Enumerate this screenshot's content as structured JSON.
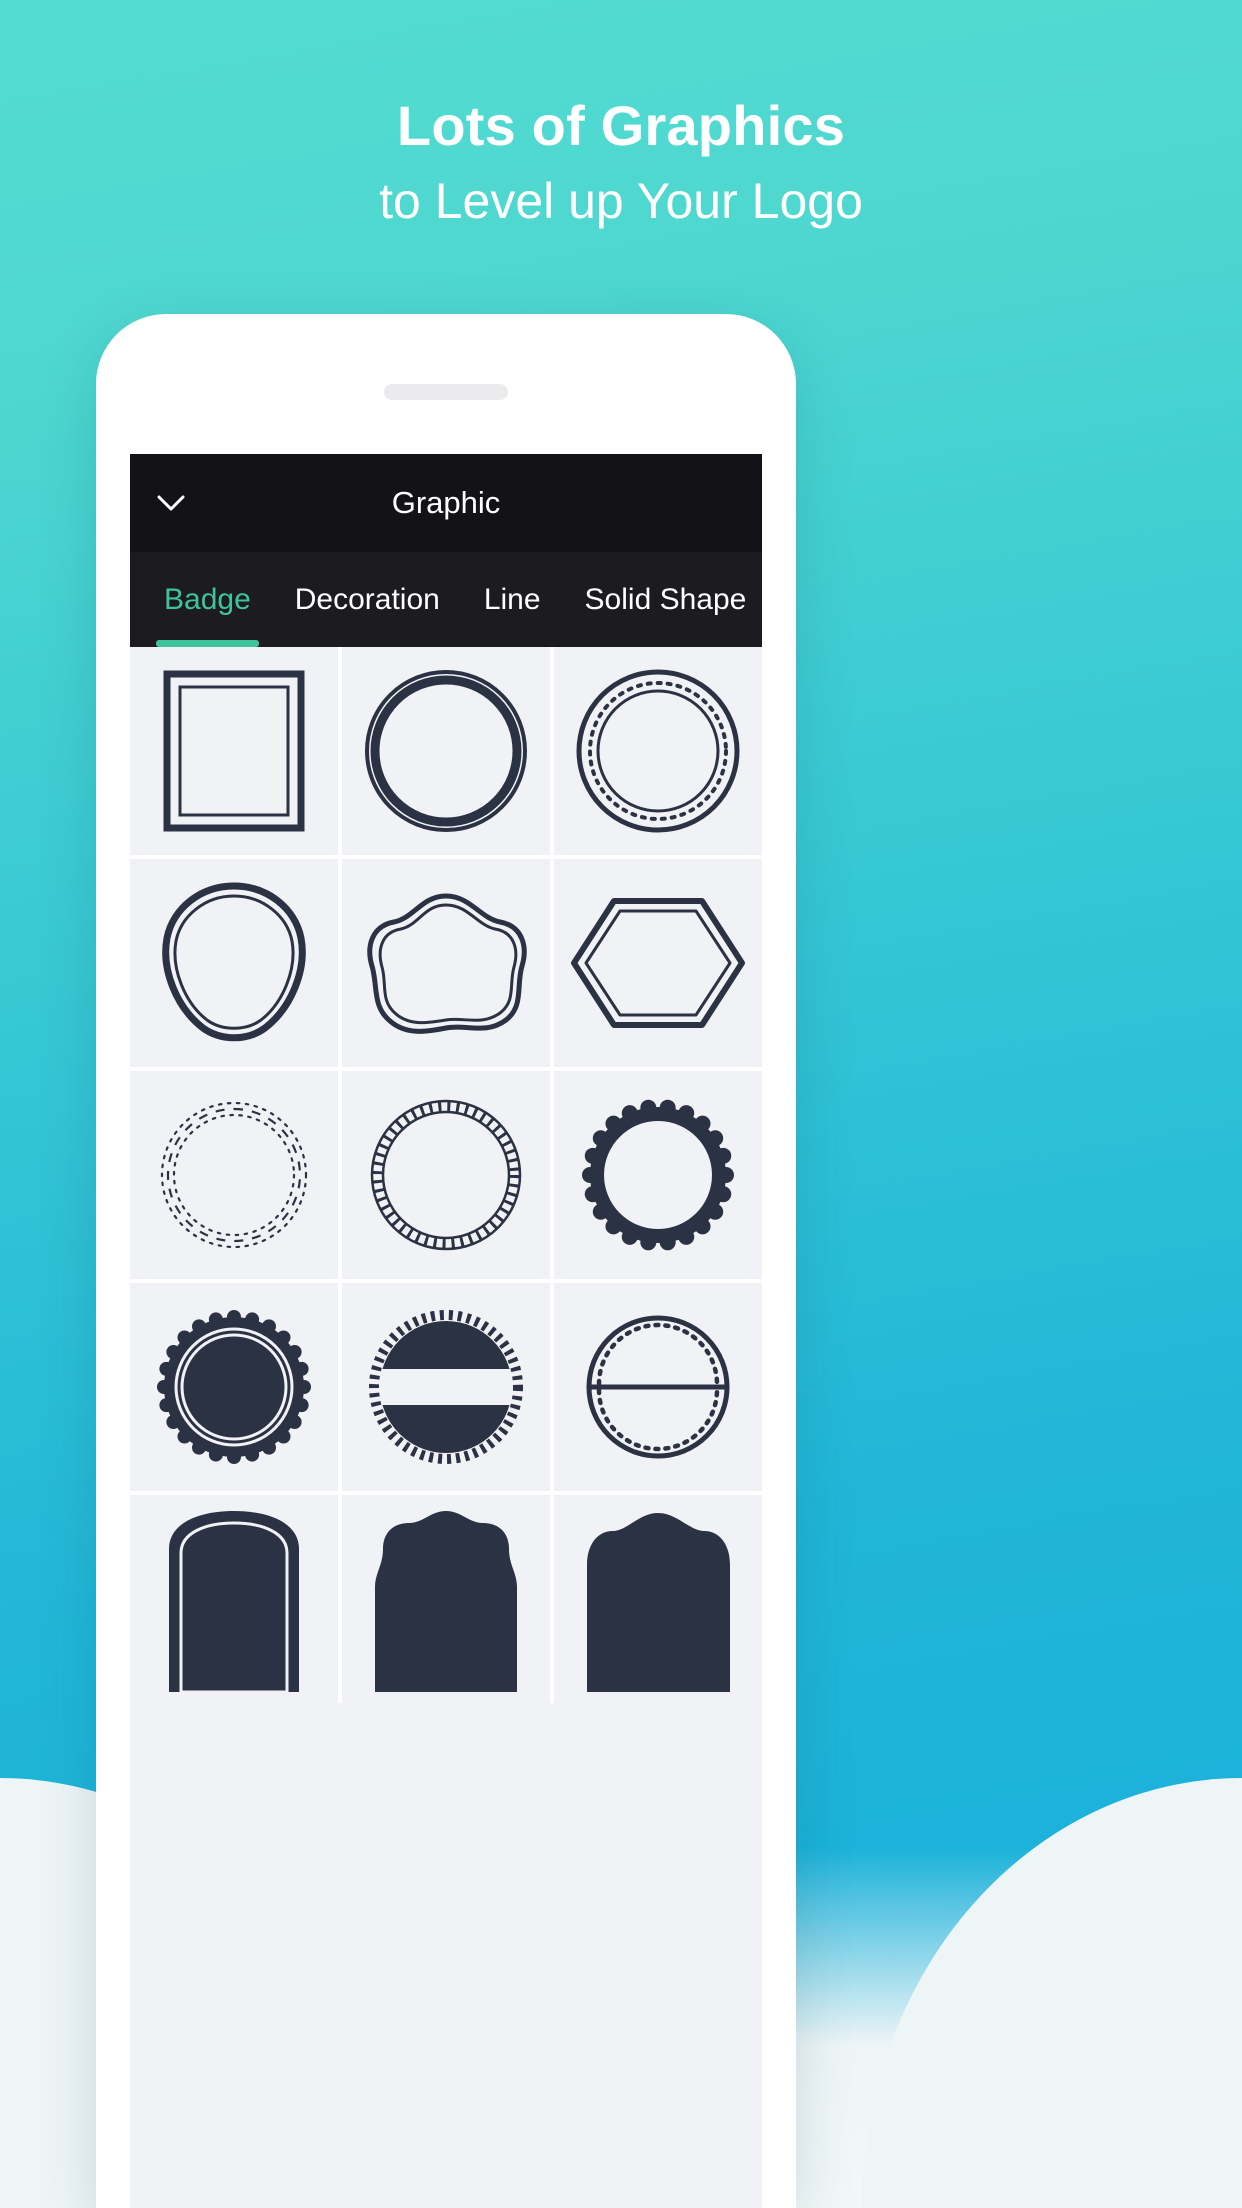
{
  "promo": {
    "headline_line1": "Lots of Graphics",
    "headline_line2": "to Level up Your Logo"
  },
  "app": {
    "header": {
      "title": "Graphic",
      "back_icon": "chevron-down-icon"
    },
    "tabs": [
      {
        "label": "Badge",
        "active": true
      },
      {
        "label": "Decoration",
        "active": false
      },
      {
        "label": "Line",
        "active": false
      },
      {
        "label": "Solid Shape",
        "active": false
      }
    ],
    "grid": {
      "columns": 3,
      "items": [
        {
          "name": "double-line-rectangle-frame"
        },
        {
          "name": "double-circle-outline"
        },
        {
          "name": "dotted-ring-circle"
        },
        {
          "name": "rounded-hexagon-outline"
        },
        {
          "name": "wavy-blob-outline"
        },
        {
          "name": "wide-hexagon-outline"
        },
        {
          "name": "scalloped-dotted-circle"
        },
        {
          "name": "rope-circle-outline"
        },
        {
          "name": "solid-scalloped-circle"
        },
        {
          "name": "solid-scalloped-badge-ring"
        },
        {
          "name": "split-banner-circle-rope"
        },
        {
          "name": "split-dotted-circle-outline"
        },
        {
          "name": "solid-arched-shield"
        },
        {
          "name": "solid-ornate-frame"
        },
        {
          "name": "solid-bracket-shape"
        }
      ]
    }
  },
  "colors": {
    "bg_gradient_top": "#53dcd1",
    "bg_gradient_bottom": "#16aedb",
    "bg_bottom_wedge": "#eef5f7",
    "appbar": "#131317",
    "tabbar": "#1b1b20",
    "tab_active": "#3fc39a",
    "cell_bg": "#f1f2f5",
    "ink": "#2b3243",
    "headline_text": "#ffffff"
  }
}
